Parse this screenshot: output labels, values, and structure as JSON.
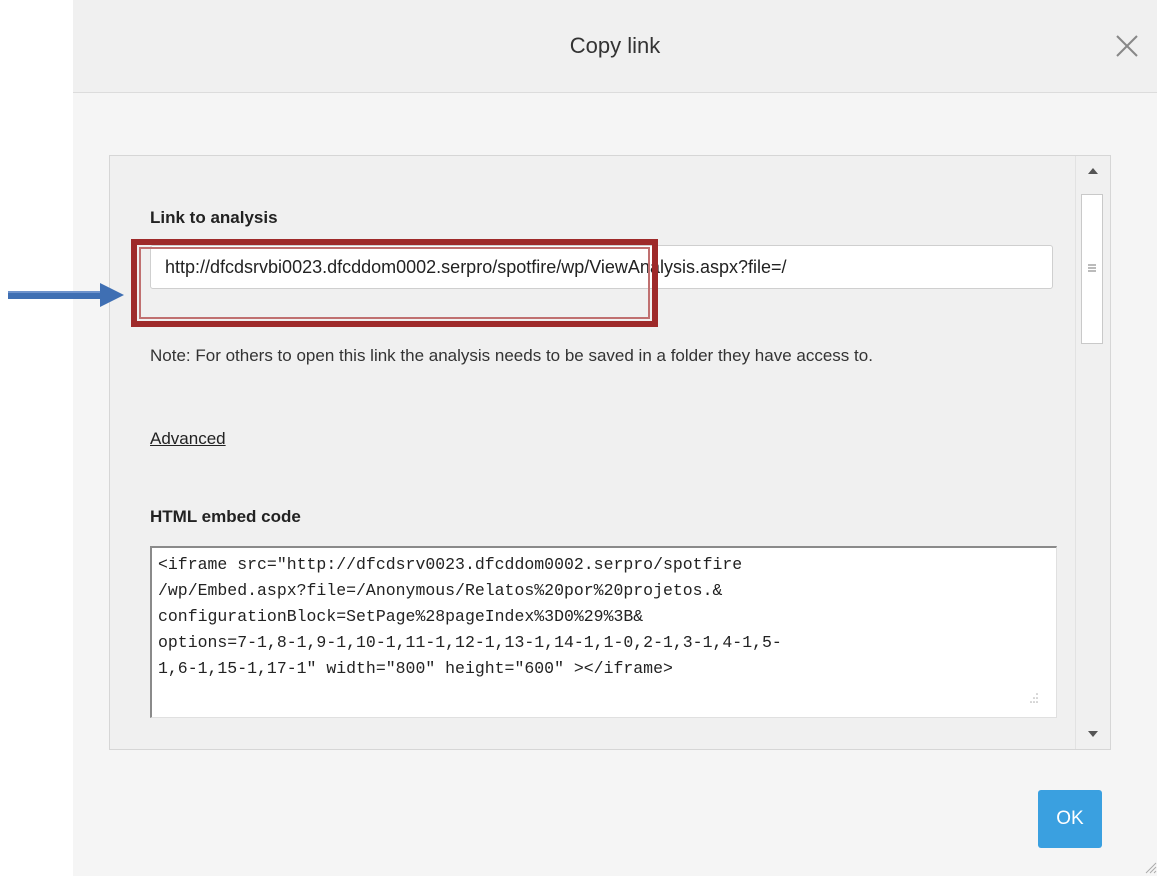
{
  "dialog": {
    "title": "Copy link",
    "close_icon": "close-icon"
  },
  "link_section": {
    "label": "Link to analysis",
    "url": "http://dfcdsrvbi0023.dfcddom0002.serpro/spotfire/wp/ViewAnalysis.aspx?file=/",
    "note": "Note: For others to open this link the analysis needs to be saved in a folder they have access to.",
    "advanced_label": "Advanced"
  },
  "embed_section": {
    "label": "HTML embed code",
    "code": "<iframe src=\"http://dfcdsrv0023.dfcddom0002.serpro/spotfire\n/wp/Embed.aspx?file=/Anonymous/Relatos%20por%20projetos.&\nconfigurationBlock=SetPage%28pageIndex%3D0%29%3B&\noptions=7-1,8-1,9-1,10-1,11-1,12-1,13-1,14-1,1-0,2-1,3-1,4-1,5-\n1,6-1,15-1,17-1\" width=\"800\" height=\"600\" ></iframe>"
  },
  "footer": {
    "ok_label": "OK"
  },
  "colors": {
    "accent": "#3aa0e0",
    "annotation_box": "#9e2a2a",
    "annotation_arrow": "#3f6fb3"
  }
}
